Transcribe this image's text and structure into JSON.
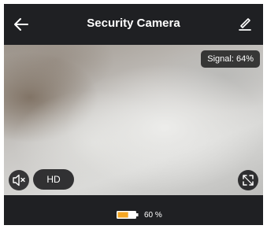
{
  "header": {
    "title": "Security Camera",
    "back_icon": "arrow-left-icon",
    "edit_icon": "pencil-icon"
  },
  "video": {
    "signal_text": "Signal: 64%"
  },
  "controls": {
    "mute_icon": "speaker-muted-icon",
    "quality_label": "HD",
    "fullscreen_icon": "expand-icon"
  },
  "footer": {
    "battery_level": 60,
    "battery_text": "60 %",
    "battery_color": "#f5a623"
  },
  "colors": {
    "background": "#1f2023",
    "text": "#ffffff"
  }
}
